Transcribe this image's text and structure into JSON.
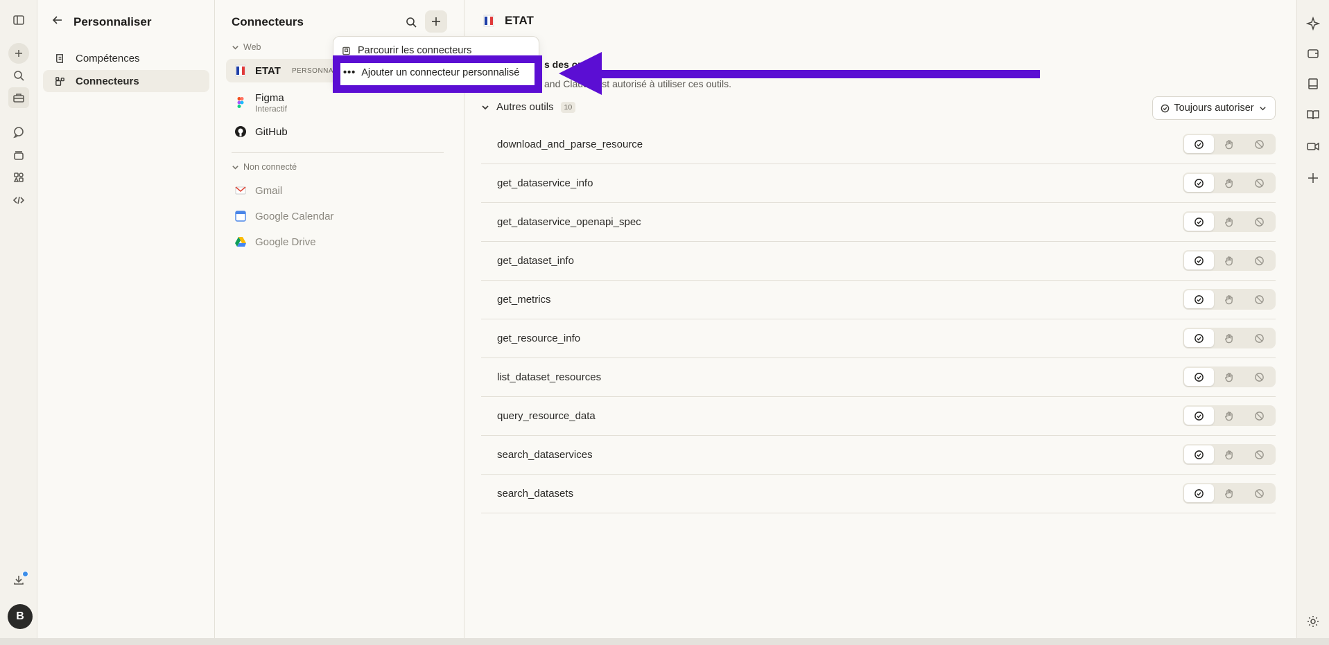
{
  "nav": {
    "title": "Personnaliser",
    "items": [
      {
        "label": "Compétences"
      },
      {
        "label": "Connecteurs"
      }
    ]
  },
  "connectors": {
    "title": "Connecteurs",
    "group_web": "Web",
    "group_disconnected": "Non connecté",
    "web_items": [
      {
        "name": "ETAT",
        "badge": "PERSONNAL"
      },
      {
        "name": "Figma",
        "sub": "Interactif"
      },
      {
        "name": "GitHub"
      }
    ],
    "disconnected_items": [
      {
        "name": "Gmail"
      },
      {
        "name": "Google Calendar"
      },
      {
        "name": "Google Drive"
      }
    ]
  },
  "menu": {
    "browse": "Parcourir les connecteurs",
    "add_custom": "Ajouter un connecteur personnalisé"
  },
  "detail": {
    "title": "ETAT",
    "perm_title": "s des outils",
    "perm_desc": "and Claude est autorisé à utiliser ces outils.",
    "section": "Autres outils",
    "count": "10",
    "always": "Toujours autoriser",
    "tools": [
      "download_and_parse_resource",
      "get_dataservice_info",
      "get_dataservice_openapi_spec",
      "get_dataset_info",
      "get_metrics",
      "get_resource_info",
      "list_dataset_resources",
      "query_resource_data",
      "search_dataservices",
      "search_datasets"
    ]
  },
  "user": {
    "initial": "B"
  },
  "colors": {
    "annotation": "#5b0ed3",
    "accent": "#3b8de8"
  }
}
